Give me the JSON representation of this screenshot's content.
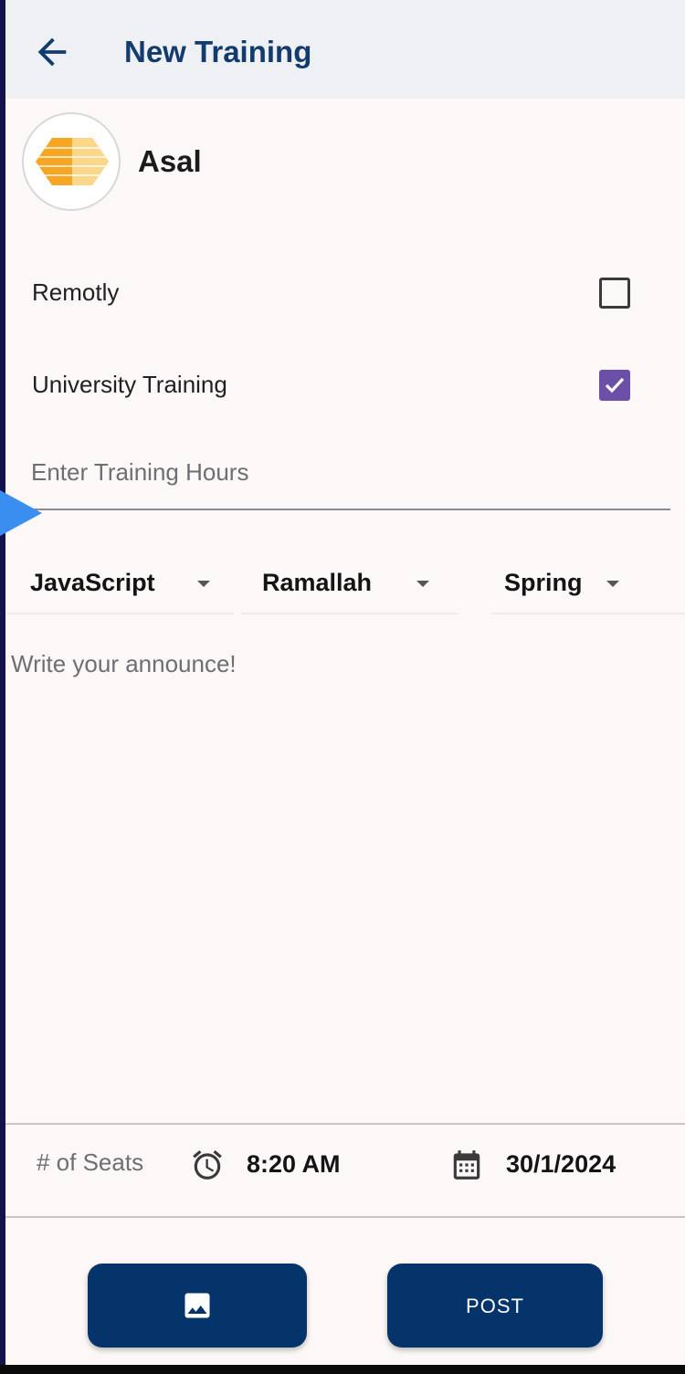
{
  "header": {
    "title": "New Training"
  },
  "company": {
    "name": "Asal",
    "logo_colors": [
      "#f6a623",
      "#fbd78a"
    ]
  },
  "options": {
    "remotely": {
      "label": "Remotly",
      "checked": false
    },
    "university": {
      "label": "University Training",
      "checked": true
    }
  },
  "hours": {
    "placeholder": "Enter Training Hours",
    "value": ""
  },
  "dropdowns": {
    "skill": {
      "selected": "JavaScript"
    },
    "city": {
      "selected": "Ramallah"
    },
    "season": {
      "selected": "Spring"
    }
  },
  "announcement": {
    "placeholder": "Write your announce!"
  },
  "footer": {
    "seats_placeholder": "# of Seats",
    "time": "8:20 AM",
    "date": "30/1/2024"
  },
  "actions": {
    "image_icon": "image-icon",
    "post_label": "POST"
  },
  "colors": {
    "primary": "#04346a",
    "title": "#123b6e",
    "checkbox": "#6b4fa8",
    "handle": "#3a8ef0"
  }
}
